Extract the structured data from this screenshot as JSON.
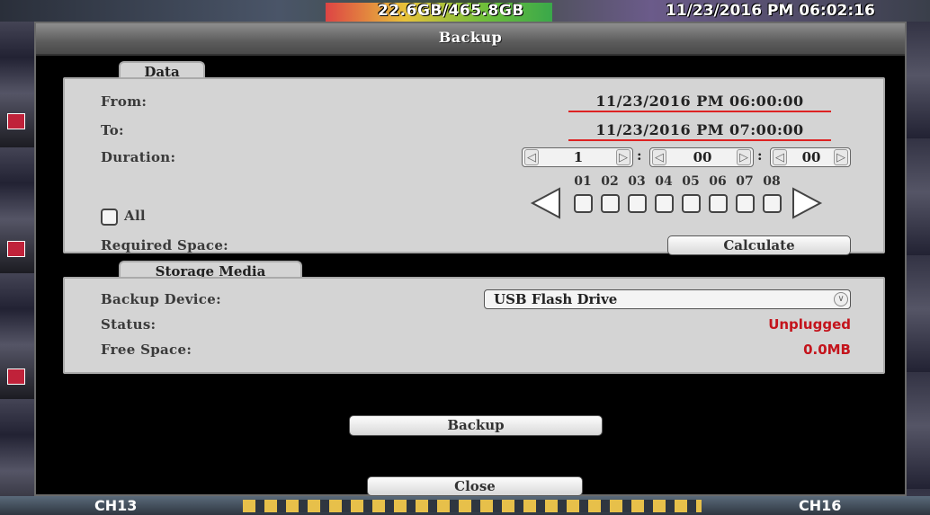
{
  "status_bar": {
    "storage": "22.6GB/465.8GB",
    "datetime": "11/23/2016 PM 06:02:16"
  },
  "bottom_bar": {
    "left_channel": "CH13",
    "right_channel": "CH16"
  },
  "dialog": {
    "title": "Backup",
    "data_group": {
      "title": "Data",
      "from_label": "From:",
      "from_value": "11/23/2016 PM 06:00:00",
      "to_label": "To:",
      "to_value": "11/23/2016 PM 07:00:00",
      "duration_label": "Duration:",
      "duration": {
        "hours": "1",
        "minutes": "00",
        "seconds": "00"
      },
      "all_label": "All",
      "channels": [
        "01",
        "02",
        "03",
        "04",
        "05",
        "06",
        "07",
        "08"
      ],
      "required_space_label": "Required Space:",
      "calculate_label": "Calculate"
    },
    "media_group": {
      "title": "Storage Media",
      "device_label": "Backup Device:",
      "device_value": "USB Flash Drive",
      "status_label": "Status:",
      "status_value": "Unplugged",
      "free_space_label": "Free Space:",
      "free_space_value": "0.0MB"
    },
    "backup_button": "Backup",
    "close_button": "Close"
  },
  "colors": {
    "status_red": "#c4141c",
    "panel_gray": "#d4d4d4"
  }
}
